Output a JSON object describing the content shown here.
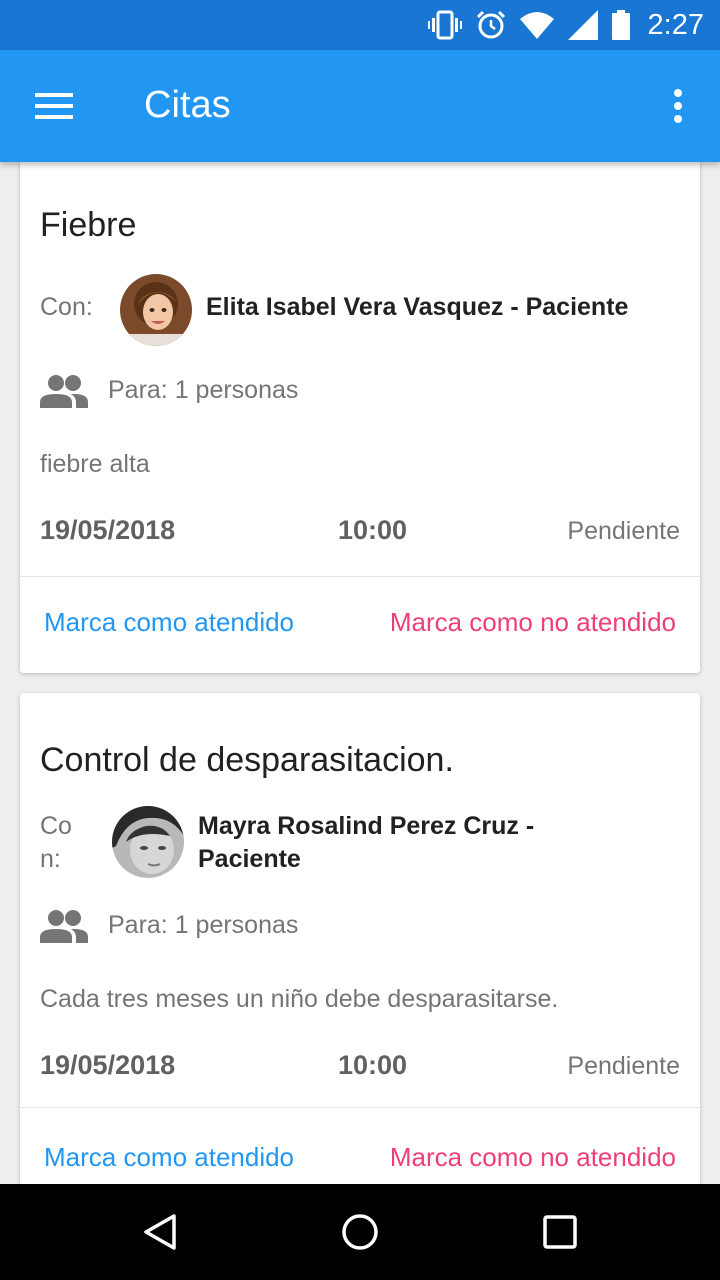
{
  "status_bar": {
    "time": "2:27"
  },
  "app_bar": {
    "title": "Citas"
  },
  "appointments": [
    {
      "title": "Fiebre",
      "con_label": "Con:",
      "person": "Elita Isabel Vera Vasquez - Paciente",
      "para": "Para: 1 personas",
      "description": "fiebre alta",
      "date": "19/05/2018",
      "time": "10:00",
      "status": "Pendiente",
      "action_attended": "Marca como atendido",
      "action_not_attended": "Marca como no atendido"
    },
    {
      "title": "Control de desparasitacion.",
      "con_label_line1": "Co",
      "con_label_line2": "n:",
      "person_line1": "Mayra Rosalind Perez Cruz -",
      "person_line2": "Paciente",
      "para": "Para: 1 personas",
      "description": "Cada tres meses un niño debe desparasitarse.",
      "date": "19/05/2018",
      "time": "10:00",
      "status": "Pendiente",
      "action_attended": "Marca como atendido",
      "action_not_attended": "Marca como no atendido"
    }
  ],
  "colors": {
    "primary": "#2196f3",
    "primary_dark": "#1976d2",
    "accent_pink": "#ef3e7a"
  },
  "icons": [
    "vibrate-icon",
    "alarm-icon",
    "wifi-icon",
    "signal-icon",
    "battery-icon",
    "menu-icon",
    "more-vert-icon",
    "group-icon",
    "back-icon",
    "home-icon",
    "recents-icon"
  ]
}
